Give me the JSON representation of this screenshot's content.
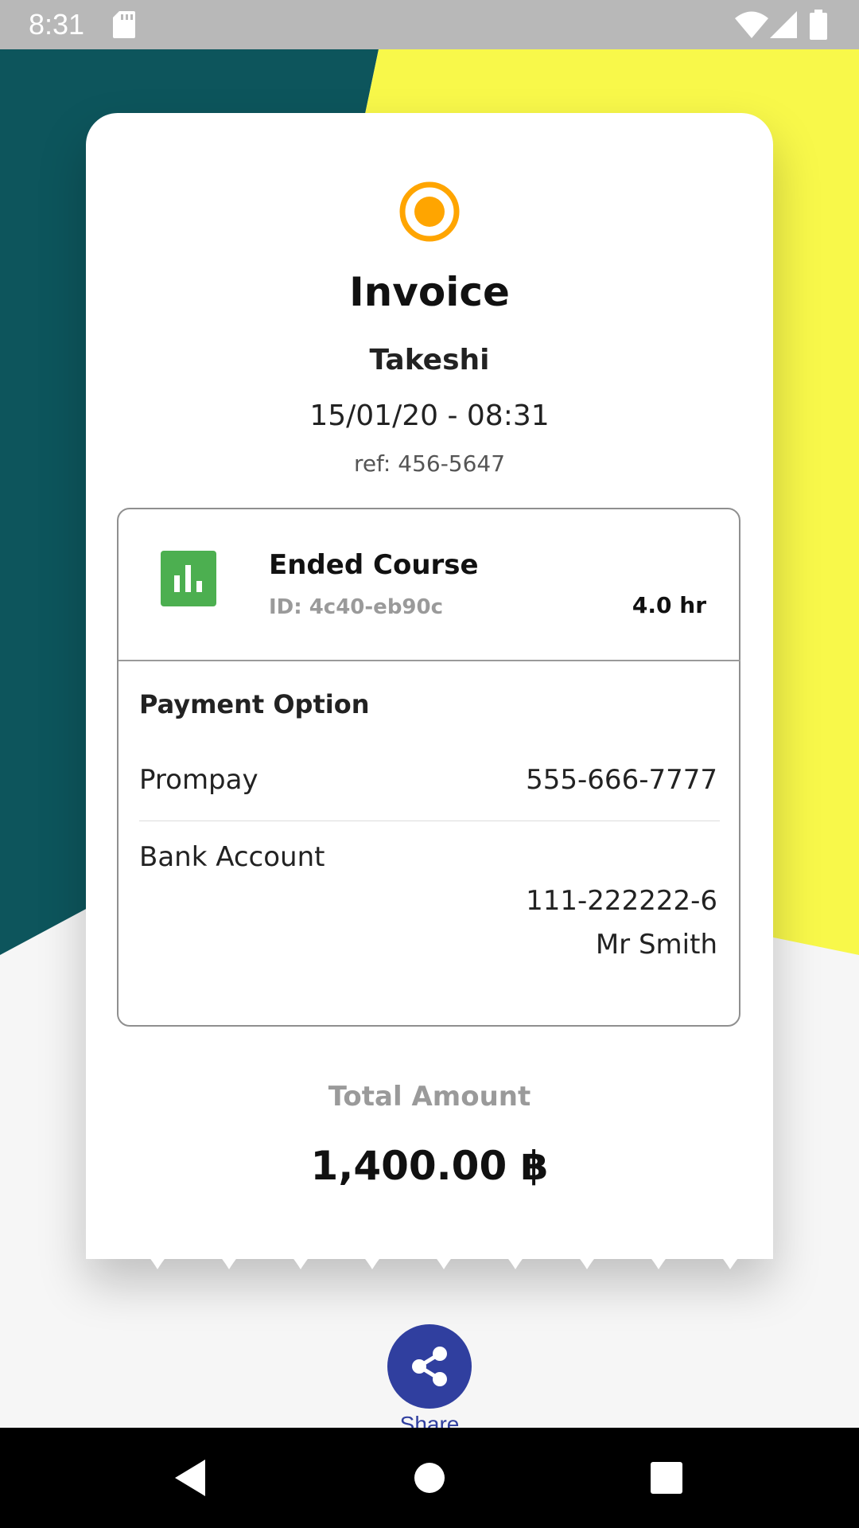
{
  "colors": {
    "teal": "#0d555c",
    "yellow": "#f8f84a",
    "accent_orange": "#ffa500",
    "course_green": "#4caf50",
    "share_blue": "#303f9f"
  },
  "status_bar": {
    "time": "8:31",
    "icons": [
      "sd-card-icon",
      "wifi-icon",
      "signal-icon",
      "battery-icon"
    ]
  },
  "invoice": {
    "icon": "radio-target-icon",
    "title": "Invoice",
    "customer": "Takeshi",
    "datetime": "15/01/20 - 08:31",
    "ref": "ref: 456-5647"
  },
  "course": {
    "icon": "bar-chart-icon",
    "title": "Ended Course",
    "id": "ID: 4c40-eb90c",
    "duration": "4.0 hr"
  },
  "payment": {
    "title": "Payment Option",
    "prompay_label": "Prompay",
    "prompay_value": "555-666-7777",
    "bank_label": "Bank Account",
    "bank_number": "111-222222-6",
    "bank_holder": "Mr Smith"
  },
  "total": {
    "label": "Total Amount",
    "value": "1,400.00 ฿"
  },
  "share": {
    "icon": "share-icon",
    "label": "Share"
  },
  "nav": {
    "icons": [
      "back-icon",
      "home-icon",
      "recents-icon"
    ]
  }
}
